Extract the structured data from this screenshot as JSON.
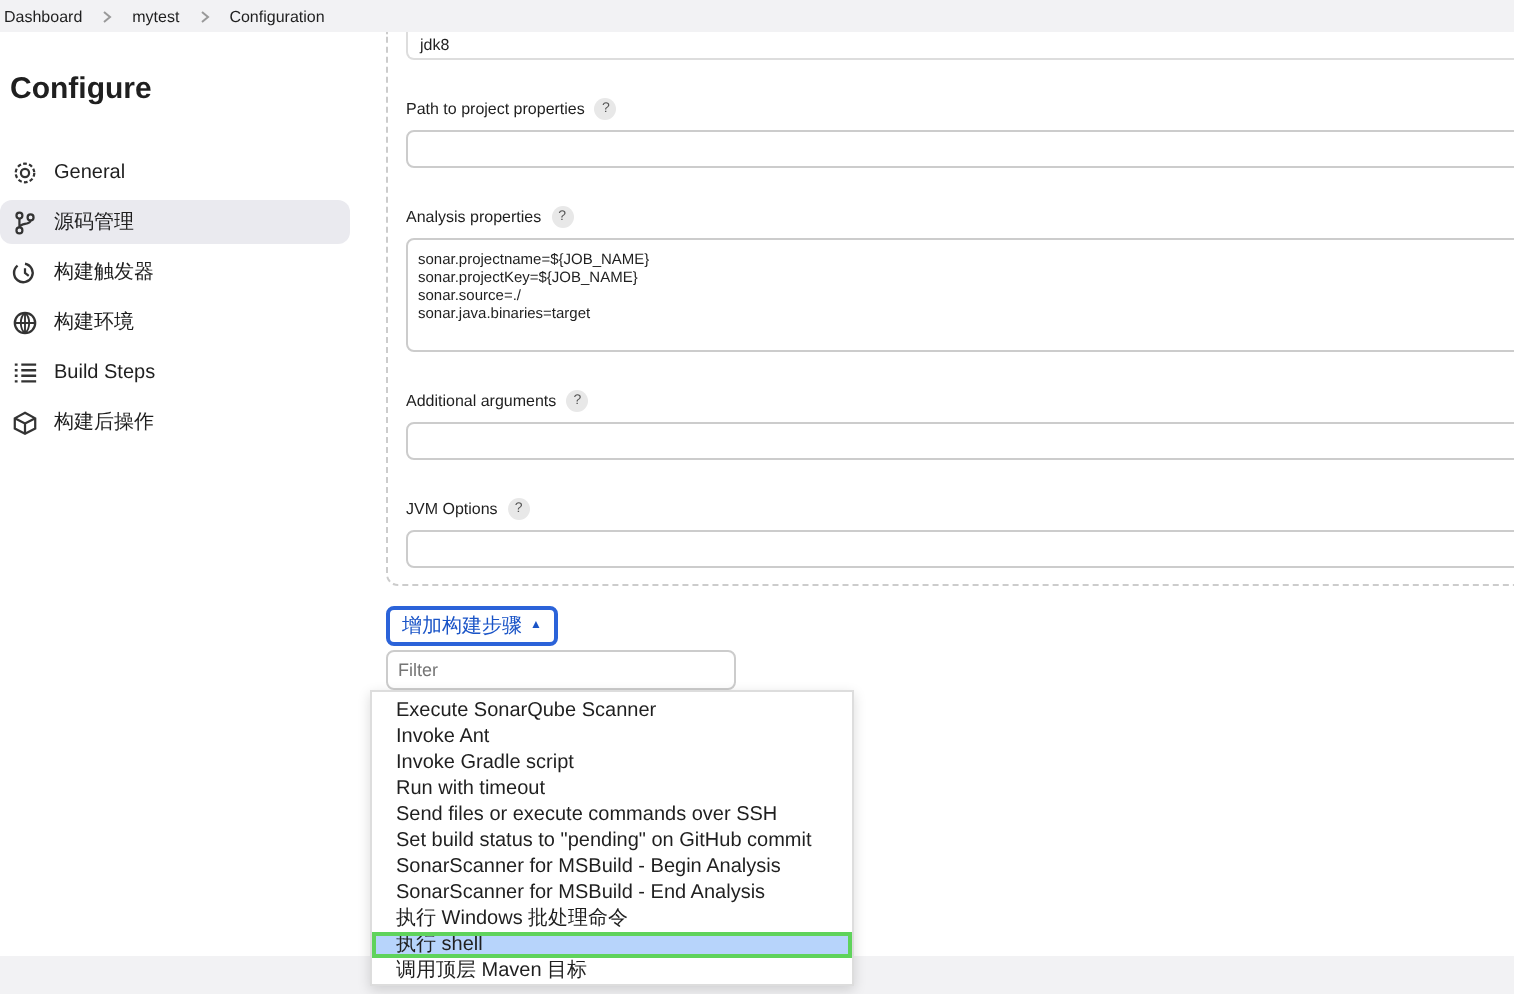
{
  "breadcrumb": [
    "Dashboard",
    "mytest",
    "Configuration"
  ],
  "sidebar": {
    "title": "Configure",
    "items": [
      {
        "label": "General",
        "selected": false
      },
      {
        "label": "源码管理",
        "selected": true
      },
      {
        "label": "构建触发器",
        "selected": false
      },
      {
        "label": "构建环境",
        "selected": false
      },
      {
        "label": "Build Steps",
        "selected": false
      },
      {
        "label": "构建后操作",
        "selected": false
      }
    ]
  },
  "jdk_field": {
    "value": "jdk8"
  },
  "fields": [
    {
      "label": "Path to project properties",
      "help": "?",
      "kind": "input"
    },
    {
      "label": "Analysis properties",
      "help": "?",
      "kind": "textarea",
      "value": "sonar.projectname=${JOB_NAME}\nsonar.projectKey=${JOB_NAME}\nsonar.source=./\nsonar.java.binaries=target"
    },
    {
      "label": "Additional arguments",
      "help": "?",
      "kind": "input"
    },
    {
      "label": "JVM Options",
      "help": "?",
      "kind": "input"
    }
  ],
  "add_step_button": {
    "label": "增加构建步骤",
    "caret": "▲"
  },
  "filter": {
    "placeholder": "Filter"
  },
  "menu_items": [
    {
      "label": "Execute SonarQube Scanner",
      "selected": false
    },
    {
      "label": "Invoke Ant",
      "selected": false
    },
    {
      "label": "Invoke Gradle script",
      "selected": false
    },
    {
      "label": "Run with timeout",
      "selected": false
    },
    {
      "label": "Send files or execute commands over SSH",
      "selected": false
    },
    {
      "label": "Set build status to \"pending\" on GitHub commit",
      "selected": false
    },
    {
      "label": "SonarScanner for MSBuild - Begin Analysis",
      "selected": false
    },
    {
      "label": "SonarScanner for MSBuild - End Analysis",
      "selected": false
    },
    {
      "label": "执行 Windows 批处理命令",
      "selected": false
    },
    {
      "label": "执行 shell",
      "selected": true
    },
    {
      "label": "调用顶层 Maven 目标",
      "selected": false
    }
  ]
}
